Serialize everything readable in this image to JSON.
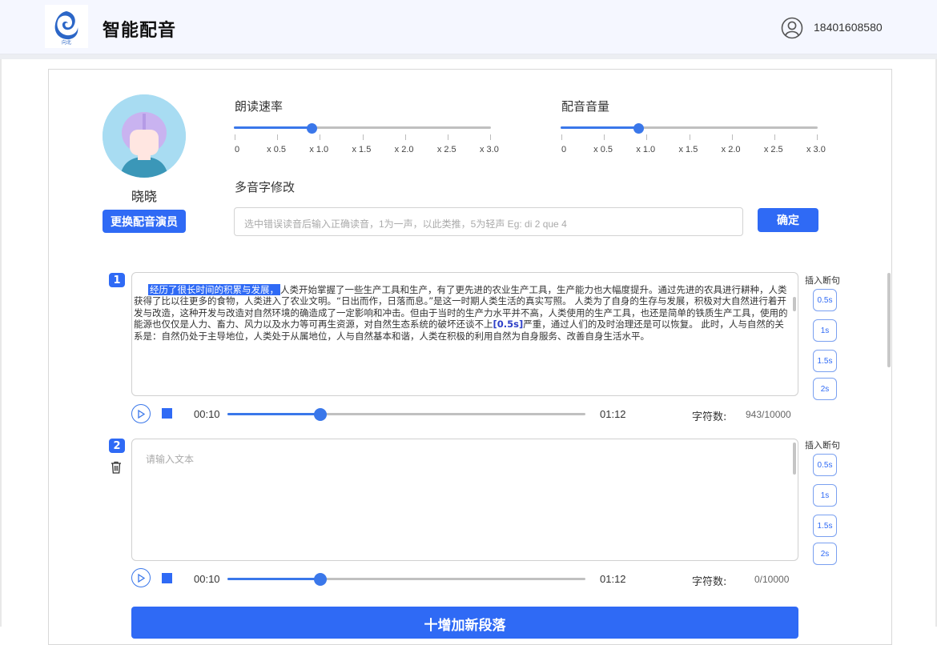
{
  "header": {
    "app_title": "智能配音",
    "logo_icon": "swirl-logo-icon",
    "user_icon": "user-circle-icon",
    "phone": "18401608580"
  },
  "voice_actor": {
    "name": "晓晓",
    "change_button": "更换配音演员"
  },
  "speed": {
    "label": "朗读速率",
    "ticks": [
      "0",
      "x 0.5",
      "x 1.0",
      "x 1.5",
      "x 2.0",
      "x 2.5",
      "x 3.0"
    ],
    "value": 0.9
  },
  "volume": {
    "label": "配音音量",
    "ticks": [
      "0",
      "x 0.5",
      "x 1.0",
      "x 1.5",
      "x 2.0",
      "x 2.5",
      "x 3.0"
    ],
    "value": 0.9
  },
  "polyphone": {
    "label": "多音字修改",
    "placeholder": "选中错误读音后输入正确读音，1为一声，以此类推，5为轻声     Eg:  di 2 que 4",
    "confirm_button": "确定"
  },
  "segments": [
    {
      "index": "1",
      "highlight": "经历了很长时间的积累与发展，",
      "text_before_pause": "人类开始掌握了一些生产工具和生产，有了更先进的农业生产工具，生产能力也大幅度提升。通过先进的农具进行耕种，人类获得了比以往更多的食物，人类进入了农业文明。“日出而作，日落而息。”是这一时期人类生活的真实写照。 人类为了自身的生存与发展，积极对大自然进行着开发与改造，这种开发与改造对自然环境的确造成了一定影响和冲击。但由于当时的生产力水平并不高，人类使用的生产工具，也还是简单的铁质生产工具，使用的能源也仅仅是人力、畜力、风力以及水力等可再生资源，对自然生态系统的破坏还谈不上",
      "pause_mark": "[0.5s]",
      "text_after_pause": "严重，通过人们的及时治理还是可以恢复。 此时，人与自然的关系是：自然仍处于主导地位，人类处于从属地位，人与自然基本和谐，人类在积极的利用自然为自身服务、改善自身生活水平。",
      "placeholder": "",
      "current_time": "00:10",
      "total_time": "01:12",
      "progress": 0.26,
      "count_label": "字符数:",
      "count": "943/10000"
    },
    {
      "index": "2",
      "highlight": "",
      "text_before_pause": "",
      "pause_mark": "",
      "text_after_pause": "",
      "placeholder": "请输入文本",
      "current_time": "00:10",
      "total_time": "01:12",
      "progress": 0.26,
      "count_label": "字符数:",
      "count": "0/10000"
    }
  ],
  "pause_panel": {
    "title": "插入断句",
    "options": [
      "0.5s",
      "1s",
      "1.5s",
      "2s"
    ]
  },
  "add_segment_button": "十增加新段落",
  "icons": {
    "play": "play-icon",
    "stop": "stop-icon",
    "delete": "trash-icon"
  },
  "colors": {
    "accent": "#2f6af5",
    "header_bg": "#f5f7ff"
  }
}
